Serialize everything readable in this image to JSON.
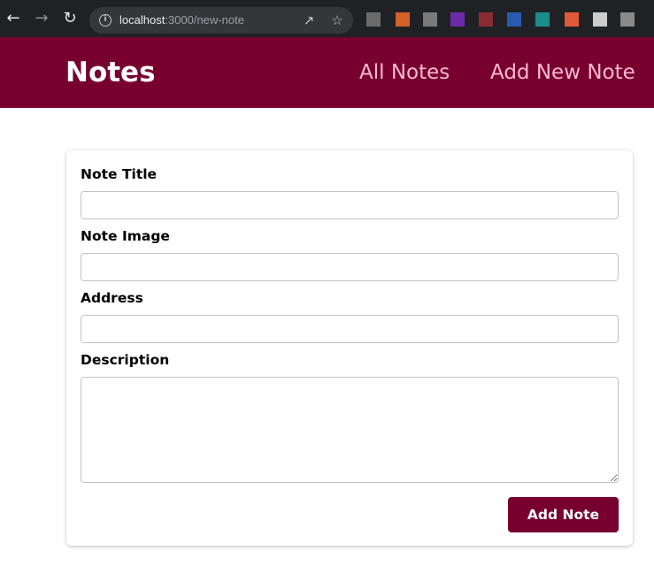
{
  "browser": {
    "url_host": "localhost",
    "url_path": ":3000/new-note",
    "extension_colors": [
      "#6b6b6b",
      "#d4602a",
      "#7a7a7a",
      "#6b2aa8",
      "#8a2a33",
      "#2a5ab0",
      "#1a8c8c",
      "#e05a3a",
      "#cccccc",
      "#8a8a8a"
    ]
  },
  "header": {
    "brand": "Notes",
    "nav": [
      {
        "label": "All Notes"
      },
      {
        "label": "Add New Note"
      }
    ]
  },
  "form": {
    "title_label": "Note Title",
    "title_value": "",
    "image_label": "Note Image",
    "image_value": "",
    "address_label": "Address",
    "address_value": "",
    "description_label": "Description",
    "description_value": "",
    "submit_label": "Add Note"
  },
  "colors": {
    "primary": "#77002e",
    "nav_link": "#fcb8d2"
  }
}
